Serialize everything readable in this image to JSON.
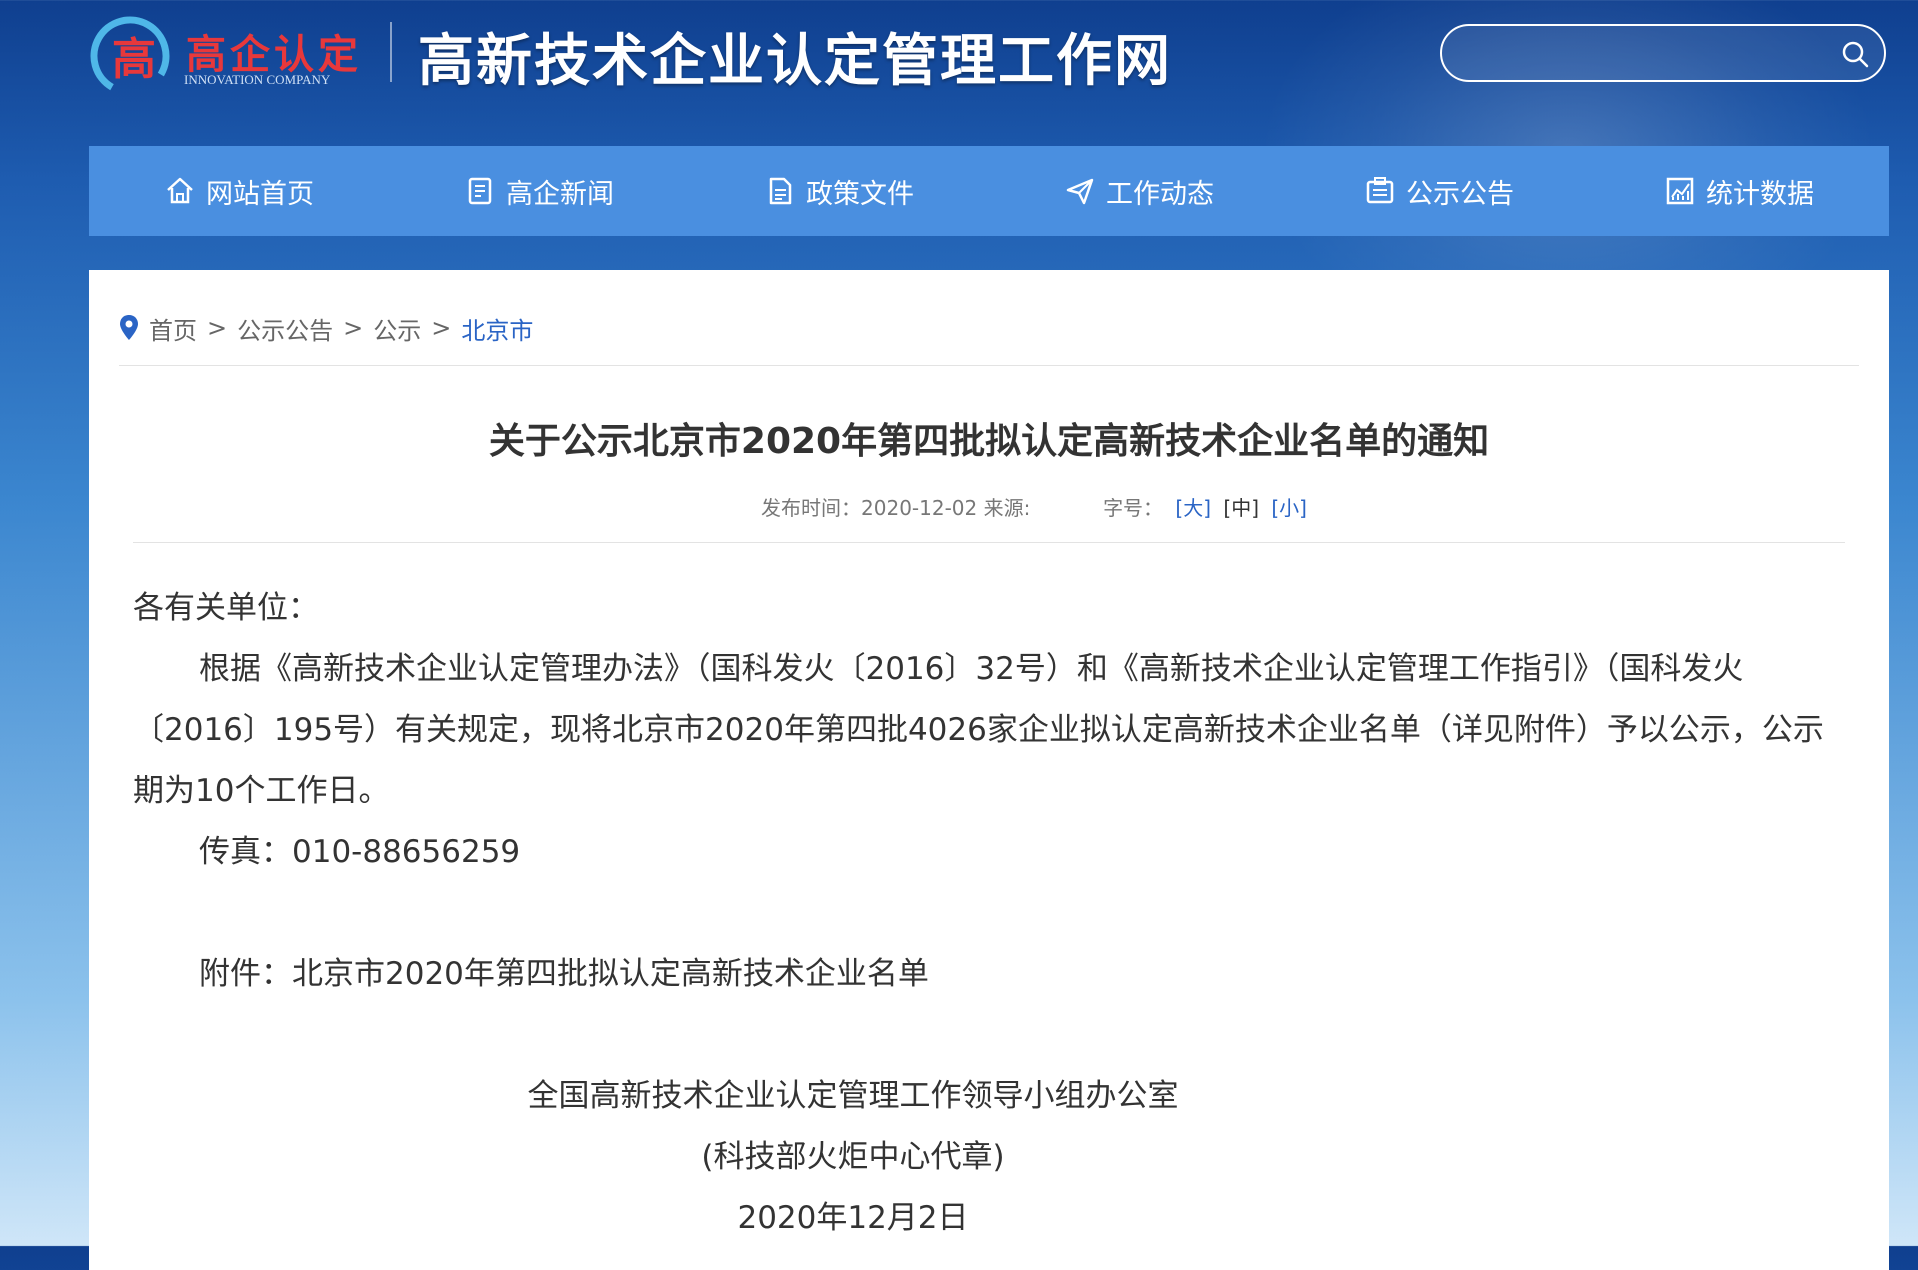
{
  "header": {
    "logo_cn": "高企认定",
    "logo_en": "INNOVATION COMPANY",
    "site_title": "高新技术企业认定管理工作网",
    "search_placeholder": ""
  },
  "nav": {
    "items": [
      {
        "label": "网站首页",
        "icon": "home-icon"
      },
      {
        "label": "高企新闻",
        "icon": "news-icon"
      },
      {
        "label": "政策文件",
        "icon": "document-icon"
      },
      {
        "label": "工作动态",
        "icon": "paper-plane-icon"
      },
      {
        "label": "公示公告",
        "icon": "notice-icon"
      },
      {
        "label": "统计数据",
        "icon": "chart-icon"
      }
    ]
  },
  "breadcrumb": {
    "items": [
      "首页",
      "公示公告",
      "公示"
    ],
    "current": "北京市",
    "separator": ">"
  },
  "article": {
    "title": "关于公示北京市2020年第四批拟认定高新技术企业名单的通知",
    "publish_label": "发布时间：2020-12-02 来源:",
    "font_size_label": "字号：",
    "font_large": "[大]",
    "font_medium": "[中]",
    "font_small": "[小]",
    "salutation": "各有关单位：",
    "paragraph1": "根据《高新技术企业认定管理办法》（国科发火〔2016〕32号）和《高新技术企业认定管理工作指引》（国科发火〔2016〕195号）有关规定，现将北京市2020年第四批4026家企业拟认定高新技术企业名单（详见附件）予以公示，公示期为10个工作日。",
    "fax": "传真：010-88656259",
    "attachment": "附件：北京市2020年第四批拟认定高新技术企业名单",
    "signature_org": "全国高新技术企业认定管理工作领导小组办公室",
    "signature_note": "(科技部火炬中心代章)",
    "signature_date": "2020年12月2日"
  },
  "colors": {
    "nav_bg": "#4a8fe0",
    "link": "#2a64c5",
    "logo_red": "#e8383b"
  }
}
